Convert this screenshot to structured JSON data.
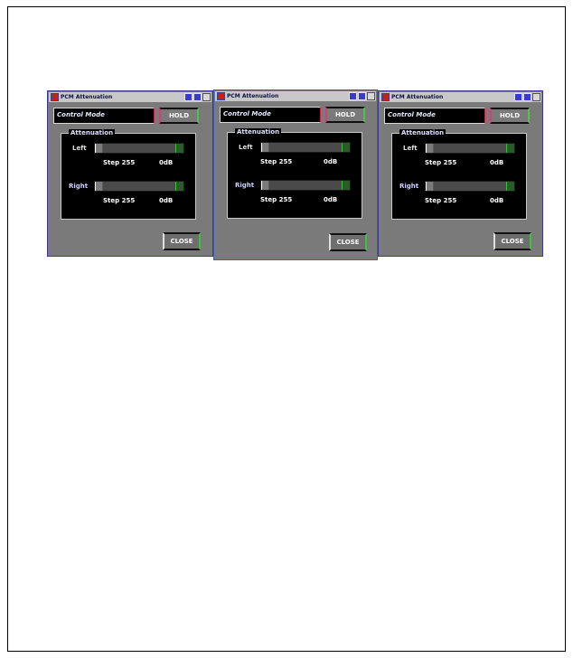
{
  "windows": [
    {
      "title": "PCM Attenuation",
      "mode_label": "Control Mode",
      "hold_label": "HOLD",
      "group_title": "Attenuation",
      "left_label": "Left",
      "left_step": "Step 255",
      "left_db": "0dB",
      "right_label": "Right",
      "right_step": "Step 255",
      "right_db": "0dB",
      "close_label": "CLOSE"
    },
    {
      "title": "PCM Attenuation",
      "mode_label": "Control Mode",
      "hold_label": "HOLD",
      "group_title": "Attenuation",
      "left_label": "Left",
      "left_step": "Step 255",
      "left_db": "0dB",
      "right_label": "Right",
      "right_step": "Step 255",
      "right_db": "0dB",
      "close_label": "CLOSE"
    },
    {
      "title": "PCM Attenuation",
      "mode_label": "Control Mode",
      "hold_label": "HOLD",
      "group_title": "Attenuation",
      "left_label": "Left",
      "left_step": "Step 255",
      "left_db": "0dB",
      "right_label": "Right",
      "right_step": "Step 255",
      "right_db": "0dB",
      "close_label": "CLOSE"
    }
  ]
}
